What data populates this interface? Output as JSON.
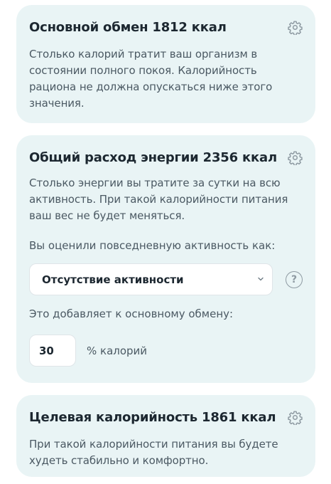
{
  "bmr": {
    "title": "Основной обмен 1812 ккал",
    "description": "Столько калорий тратит ваш организм в состоянии полного покоя. Калорийность рациона не должна опускаться ниже этого значения."
  },
  "tdee": {
    "title": "Общий расход энергии 2356 ккал",
    "description": "Столько энергии вы тратите за сутки на всю активность. При такой калорийности питания ваш вес не будет меняться.",
    "activity_label": "Вы оценили повседневную активность как:",
    "activity_value": "Отсутствие активности",
    "help_symbol": "?",
    "adds_label": "Это добавляет к основному обмену:",
    "percent_value": "30",
    "percent_unit": "% калорий"
  },
  "target": {
    "title": "Целевая калорийность 1861 ккал",
    "description": "При такой калорийности питания вы будете худеть стабильно и комфортно."
  },
  "icons": {
    "settings": "gear-icon",
    "dropdown": "chevron-down-icon",
    "help": "question-circle-icon"
  },
  "colors": {
    "card_background": "#e9f4f5",
    "title_text": "#1c2730",
    "body_text": "#4b5963",
    "icon": "#8e9aa2"
  }
}
